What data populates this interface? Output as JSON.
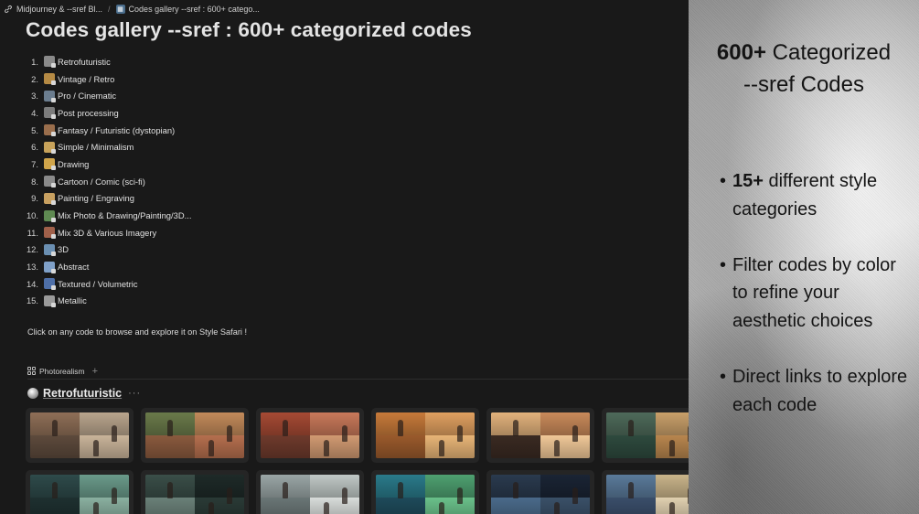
{
  "breadcrumb": {
    "items": [
      {
        "icon": "link-icon",
        "label": "Midjourney & --sref Bl..."
      },
      {
        "icon": "gallery-icon",
        "label": "Codes gallery --sref : 600+ catego..."
      }
    ],
    "separator": "/"
  },
  "page": {
    "title": "Codes gallery --sref : 600+ categorized codes",
    "note": "Click on any code to browse and explore it on Style Safari !"
  },
  "categories": [
    {
      "num": "1.",
      "label": "Retrofuturistic",
      "color": "#8a8a8a"
    },
    {
      "num": "2.",
      "label": "Vintage / Retro",
      "color": "#b58a44"
    },
    {
      "num": "3.",
      "label": "Pro / Cinematic",
      "color": "#6b7d8f"
    },
    {
      "num": "4.",
      "label": "Post processing",
      "color": "#7c7c7c"
    },
    {
      "num": "5.",
      "label": "Fantasy / Futuristic (dystopian)",
      "color": "#9a6e4c"
    },
    {
      "num": "6.",
      "label": "Simple / Minimalism",
      "color": "#c7a25a"
    },
    {
      "num": "7.",
      "label": "Drawing",
      "color": "#d0a54a"
    },
    {
      "num": "8.",
      "label": "Cartoon / Comic (sci-fi)",
      "color": "#8a8a8a"
    },
    {
      "num": "9.",
      "label": "Painting / Engraving",
      "color": "#c8a060"
    },
    {
      "num": "10.",
      "label": "Mix Photo & Drawing/Painting/3D...",
      "color": "#5f8a52"
    },
    {
      "num": "11.",
      "label": "Mix 3D & Various Imagery",
      "color": "#a0604a"
    },
    {
      "num": "12.",
      "label": "3D",
      "color": "#6a8fb2"
    },
    {
      "num": "13.",
      "label": "Abstract",
      "color": "#7fa0c8"
    },
    {
      "num": "14.",
      "label": "Textured / Volumetric",
      "color": "#4e6fa8"
    },
    {
      "num": "15.",
      "label": "Metallic",
      "color": "#9a9a9a"
    }
  ],
  "view": {
    "tab_label": "Photorealism",
    "add_label": "+"
  },
  "section": {
    "title": "Retrofuturistic",
    "more": "···"
  },
  "gallery": {
    "rows": [
      [
        {
          "palette": [
            "#8f6f57",
            "#b9a58d",
            "#5d4a3c",
            "#c9b49a"
          ]
        },
        {
          "palette": [
            "#6a7a4a",
            "#c28a5a",
            "#8a5a3e",
            "#b56f4e"
          ]
        },
        {
          "palette": [
            "#a64a34",
            "#c9795a",
            "#6e3a2c",
            "#d19a72"
          ]
        },
        {
          "palette": [
            "#c77a3a",
            "#e0a060",
            "#9a5a2c",
            "#e8b577"
          ]
        },
        {
          "palette": [
            "#e2b27c",
            "#c98a5a",
            "#3a2a22",
            "#f0c898"
          ]
        },
        {
          "palette": [
            "#4e6a5a",
            "#c9a06a",
            "#2e4a3e",
            "#b8864e"
          ]
        }
      ],
      [
        {
          "palette": [
            "#2e4a4a",
            "#6a9a8a",
            "#1e3030",
            "#8ab0a0"
          ]
        },
        {
          "palette": [
            "#3a4e48",
            "#1e2a28",
            "#6a8078",
            "#2a3a36"
          ]
        },
        {
          "palette": [
            "#9aa6a6",
            "#c0c8c6",
            "#6a7676",
            "#d8dcda"
          ]
        },
        {
          "palette": [
            "#2a7a8a",
            "#4ea070",
            "#1e4a5a",
            "#6ac08a"
          ]
        },
        {
          "palette": [
            "#2a3a4e",
            "#1a2434",
            "#4a6a8a",
            "#3a5068"
          ]
        },
        {
          "palette": [
            "#5a7a9a",
            "#c9b48a",
            "#3a4e6a",
            "#e0d0b0"
          ]
        }
      ]
    ]
  },
  "promo": {
    "title_bold": "600+",
    "title_rest": " Categorized",
    "title_line2": "--sref Codes",
    "bullets": [
      {
        "bold": "15+",
        "text": " different style categories"
      },
      {
        "bold": "",
        "text": "Filter codes by color to refine your aesthetic choices"
      },
      {
        "bold": "",
        "text": "Direct links to explore each code"
      }
    ]
  }
}
